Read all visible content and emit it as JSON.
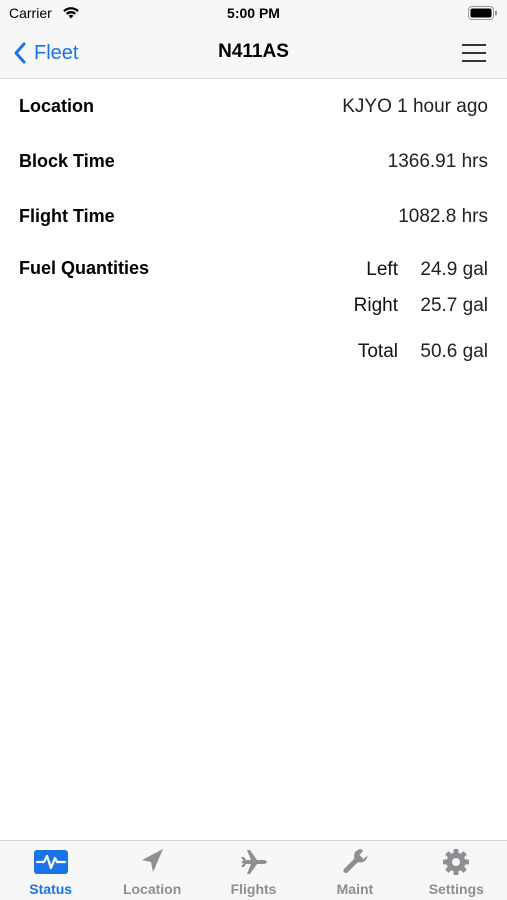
{
  "status_bar": {
    "carrier": "Carrier",
    "time": "5:00 PM"
  },
  "nav": {
    "back_label": "Fleet",
    "title": "N411AS"
  },
  "details": {
    "location_label": "Location",
    "location_value": "KJYO 1 hour ago",
    "block_time_label": "Block Time",
    "block_time_value": "1366.91 hrs",
    "flight_time_label": "Flight Time",
    "flight_time_value": "1082.8 hrs",
    "fuel_label": "Fuel Quantities",
    "fuel": [
      {
        "name": "Left",
        "amount": "24.9 gal"
      },
      {
        "name": "Right",
        "amount": "25.7 gal"
      },
      {
        "name": "Total",
        "amount": "50.6 gal"
      }
    ]
  },
  "tabs": [
    {
      "label": "Status",
      "icon": "heartbeat-icon",
      "active": true
    },
    {
      "label": "Location",
      "icon": "location-arrow-icon",
      "active": false
    },
    {
      "label": "Flights",
      "icon": "airplane-icon",
      "active": false
    },
    {
      "label": "Maint",
      "icon": "wrench-icon",
      "active": false
    },
    {
      "label": "Settings",
      "icon": "gear-icon",
      "active": false
    }
  ],
  "colors": {
    "accent": "#1a73e8",
    "inactive_tab": "#8e8e93",
    "bar_background": "#f7f7f7"
  }
}
